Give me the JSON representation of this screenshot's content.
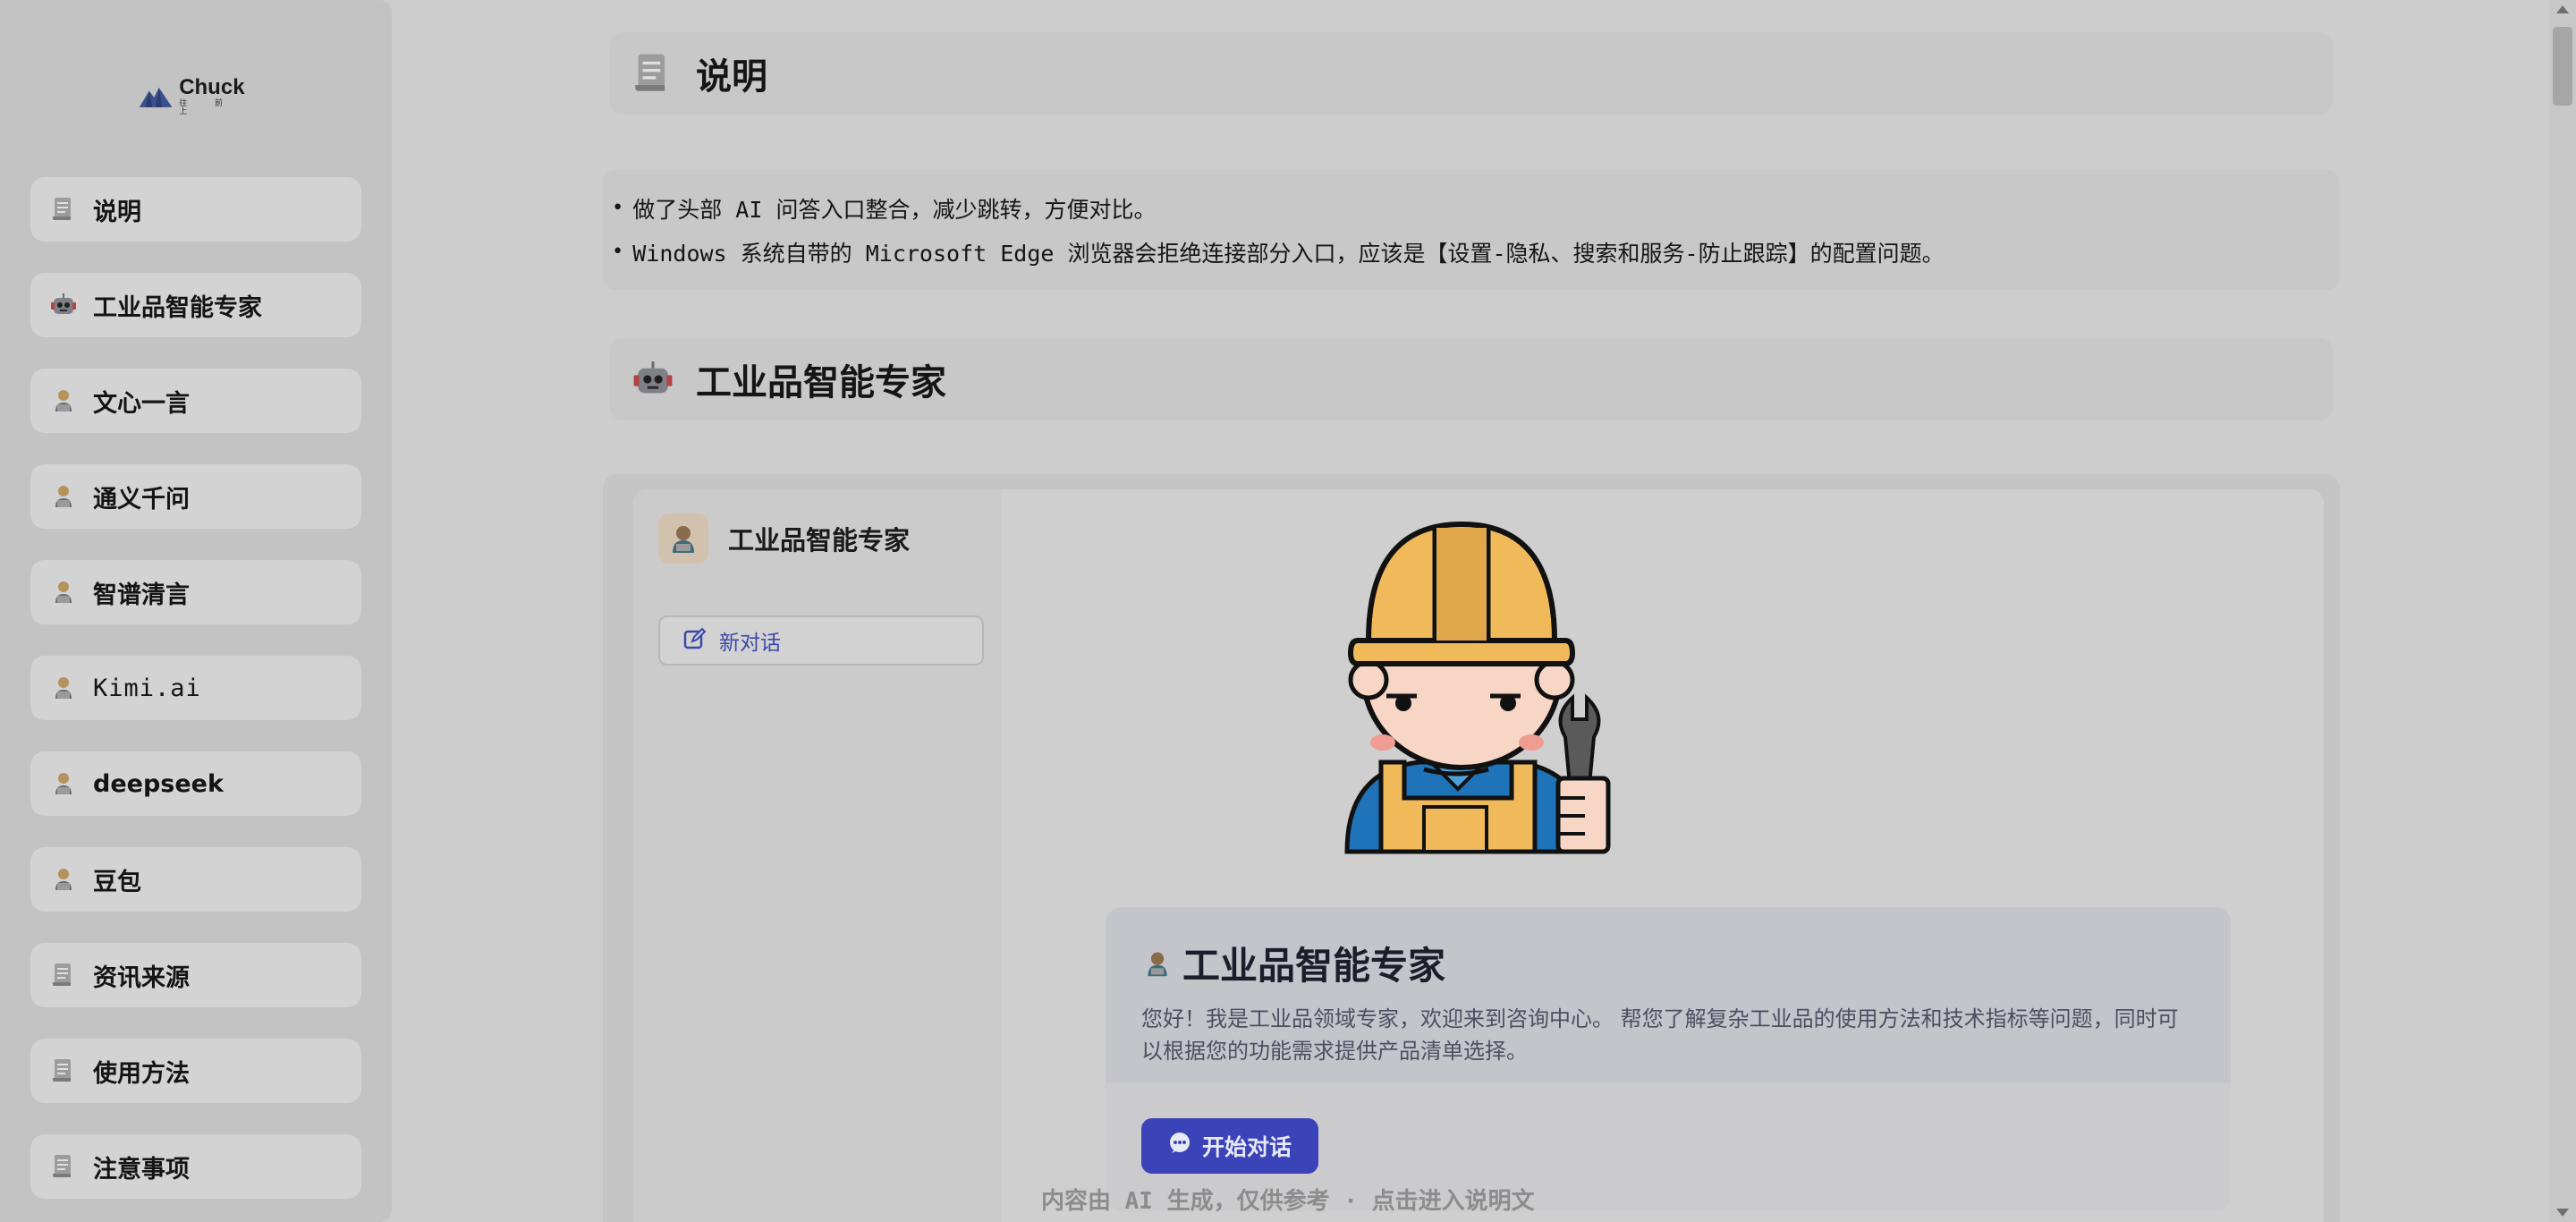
{
  "logo": {
    "name": "Chuck",
    "sub": "往 前 上",
    "icon": "mountain-logo-icon"
  },
  "sidebar": {
    "items": [
      {
        "label": "说明",
        "icon": "document-icon"
      },
      {
        "label": "工业品智能专家",
        "icon": "robot-icon"
      },
      {
        "label": "文心一言",
        "icon": "person-laptop-icon"
      },
      {
        "label": "通义千问",
        "icon": "person-laptop-icon"
      },
      {
        "label": "智谱清言",
        "icon": "person-laptop-icon"
      },
      {
        "label": "Kimi.ai",
        "icon": "person-laptop-icon"
      },
      {
        "label": "deepseek",
        "icon": "person-laptop-icon"
      },
      {
        "label": "豆包",
        "icon": "person-laptop-icon"
      },
      {
        "label": "资讯来源",
        "icon": "document-icon"
      },
      {
        "label": "使用方法",
        "icon": "document-icon"
      },
      {
        "label": "注意事项",
        "icon": "document-icon"
      }
    ]
  },
  "sections": {
    "intro": {
      "title": "说明",
      "icon": "document-icon"
    },
    "expert": {
      "title": "工业品智能专家",
      "icon": "robot-icon"
    }
  },
  "notes": [
    "做了头部 AI 问答入口整合，减少跳转，方便对比。",
    "Windows 系统自带的 Microsoft Edge 浏览器会拒绝连接部分入口，应该是【设置-隐私、搜索和服务-防止跟踪】的配置问题。"
  ],
  "chat": {
    "assistant_name": "工业品智能专家",
    "new_chat_label": "新对话",
    "welcome": {
      "title": "工业品智能专家",
      "description": "您好！我是工业品领域专家，欢迎来到咨询中心。 帮您了解复杂工业品的使用方法和技术指标等问题，同时可以根据您的功能需求提供产品清单选择。",
      "start_label": "开始对话"
    }
  },
  "footer": {
    "note": "内容由 AI 生成，仅供参考 · 点击进入说明文"
  },
  "colors": {
    "accent": "#3a44b8",
    "background": "#cdcdcd",
    "sidebar": "#c3c3c3"
  }
}
